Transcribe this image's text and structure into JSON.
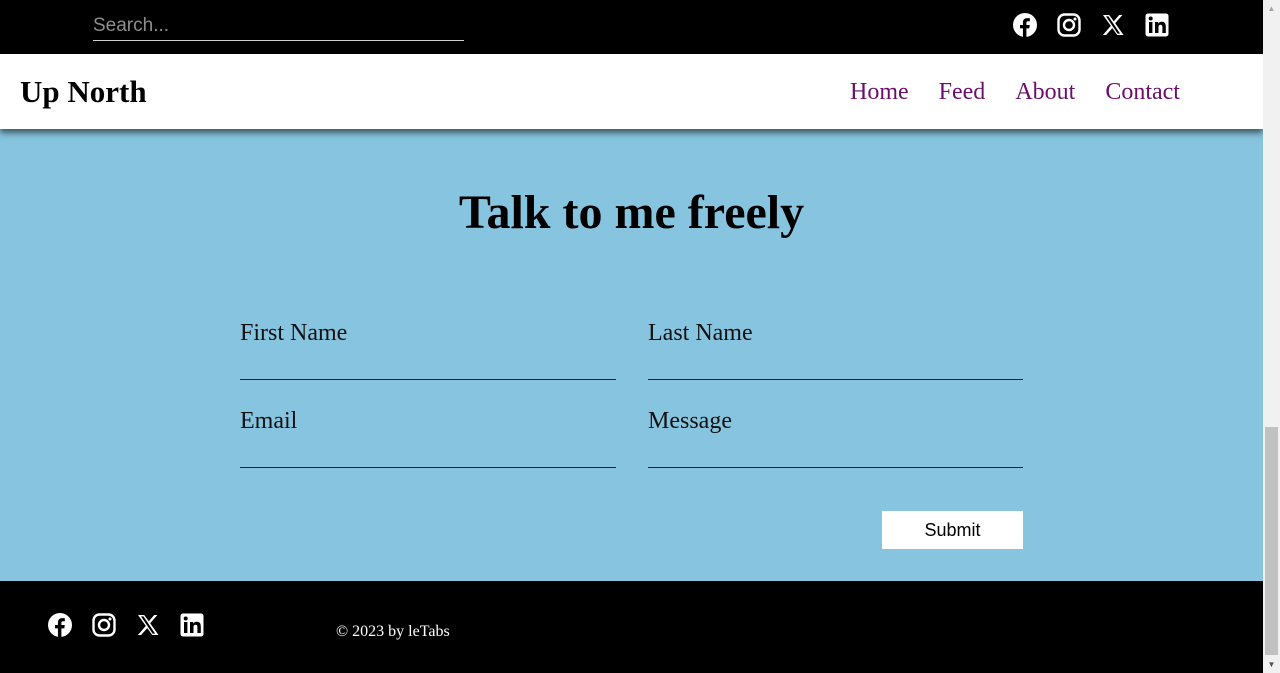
{
  "search": {
    "placeholder": "Search..."
  },
  "social_icons": [
    "facebook-icon",
    "instagram-icon",
    "x-icon",
    "linkedin-icon"
  ],
  "brand": "Up North",
  "nav": [
    "Home",
    "Feed",
    "About",
    "Contact"
  ],
  "contact": {
    "title": "Talk to me freely",
    "fields": {
      "first_name": "First Name",
      "last_name": "Last Name",
      "email": "Email",
      "message": "Message"
    },
    "submit_label": "Submit"
  },
  "footer": {
    "copyright": "© 2023 by leTabs"
  },
  "colors": {
    "topbar_bg": "#000000",
    "header_bg": "#ffffff",
    "nav_link": "#6b0f6b",
    "section_bg": "#87c4df",
    "footer_bg": "#000000"
  }
}
